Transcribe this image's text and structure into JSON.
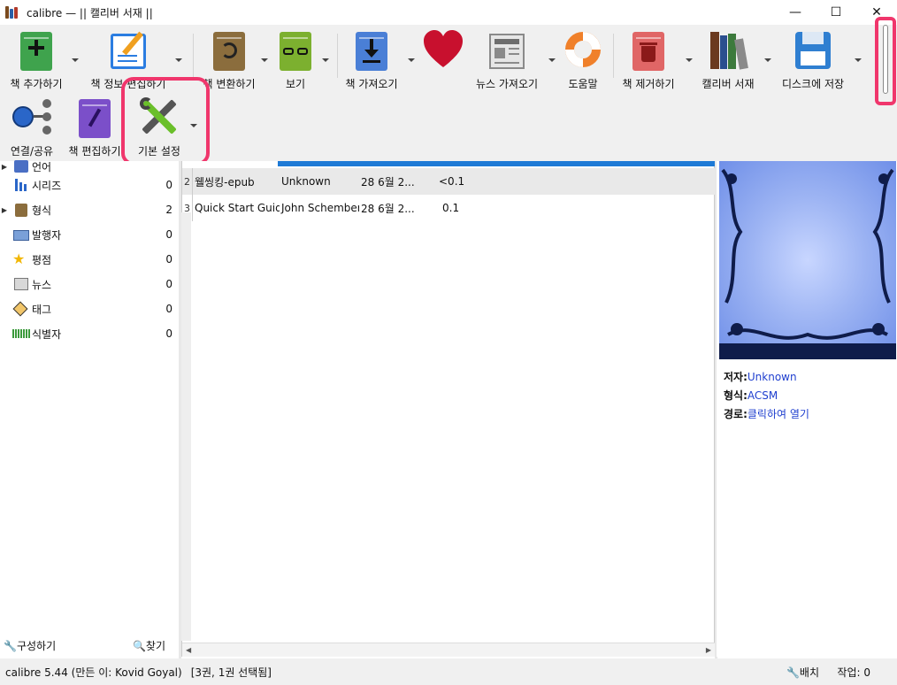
{
  "window": {
    "title": "calibre — || 캘리버 서재 ||",
    "minimize": "—",
    "maximize": "☐",
    "close": "✕"
  },
  "toolbar": {
    "buttons": [
      {
        "label": "책 추가하기",
        "icon": "add-book-icon",
        "color": "#3fa34d"
      },
      {
        "label": "책 정보 편집하기",
        "icon": "edit-metadata-icon",
        "color": "#2b7de1"
      },
      {
        "label": "책 변환하기",
        "icon": "convert-book-icon",
        "color": "#8b6d3d"
      },
      {
        "label": "보기",
        "icon": "view-book-icon",
        "color": "#7cb02f"
      },
      {
        "label": "책 가져오기",
        "icon": "get-books-icon",
        "color": "#4a7fd6"
      },
      {
        "label": "",
        "icon": "heart-icon",
        "color": "#c8102e"
      },
      {
        "label": "뉴스 가져오기",
        "icon": "news-icon",
        "color": "#999999"
      },
      {
        "label": "도움말",
        "icon": "help-lifebuoy-icon",
        "color": "#f0802a"
      },
      {
        "label": "책 제거하기",
        "icon": "remove-book-icon",
        "color": "#d9534f"
      },
      {
        "label": "캘리버 서재",
        "icon": "library-icon",
        "color": "#6b4b2f"
      },
      {
        "label": "디스크에 저장",
        "icon": "save-disk-icon",
        "color": "#2f7fd1"
      },
      {
        "label": "연결/공유",
        "icon": "connect-share-icon",
        "color": "#2a66c8"
      },
      {
        "label": "책 편집하기",
        "icon": "edit-book-icon",
        "color": "#7b4fc9"
      },
      {
        "label": "기본 설정",
        "icon": "preferences-tools-icon",
        "color": "#6abf2a"
      }
    ]
  },
  "sidebar": {
    "items": [
      {
        "label": "언어",
        "count": "",
        "icon": "language-icon",
        "expandable": true
      },
      {
        "label": "시리즈",
        "count": "0",
        "icon": "series-icon",
        "expandable": false
      },
      {
        "label": "형식",
        "count": "2",
        "icon": "format-icon",
        "expandable": true
      },
      {
        "label": "발행자",
        "count": "0",
        "icon": "publisher-icon",
        "expandable": false
      },
      {
        "label": "평점",
        "count": "0",
        "icon": "rating-star-icon",
        "expandable": false
      },
      {
        "label": "뉴스",
        "count": "0",
        "icon": "news-icon",
        "expandable": false
      },
      {
        "label": "태그",
        "count": "0",
        "icon": "tag-icon",
        "expandable": false
      },
      {
        "label": "식별자",
        "count": "0",
        "icon": "identifier-barcode-icon",
        "expandable": false
      }
    ],
    "configure": "구성하기",
    "find": "찾기"
  },
  "books": [
    {
      "num": "2",
      "title": "웰씽킹-epub",
      "author": "Unknown",
      "date": "28 6월 2...",
      "size": "<0.1",
      "selected": true
    },
    {
      "num": "3",
      "title": "Quick Start Guide",
      "author": "John Schember",
      "date": "28 6월 2...",
      "size": "0.1",
      "selected": false
    }
  ],
  "details": {
    "author_key": "저자:",
    "author_val": "Unknown",
    "format_key": "형식:",
    "format_val": "ACSM",
    "path_key": "경로:",
    "path_val": "클릭하여 열기"
  },
  "status": {
    "version": "calibre 5.44 (만든 이: Kovid Goyal)",
    "selection": "[3권, 1권 선택됨]",
    "layout": "배치",
    "jobs": "작업: 0"
  }
}
